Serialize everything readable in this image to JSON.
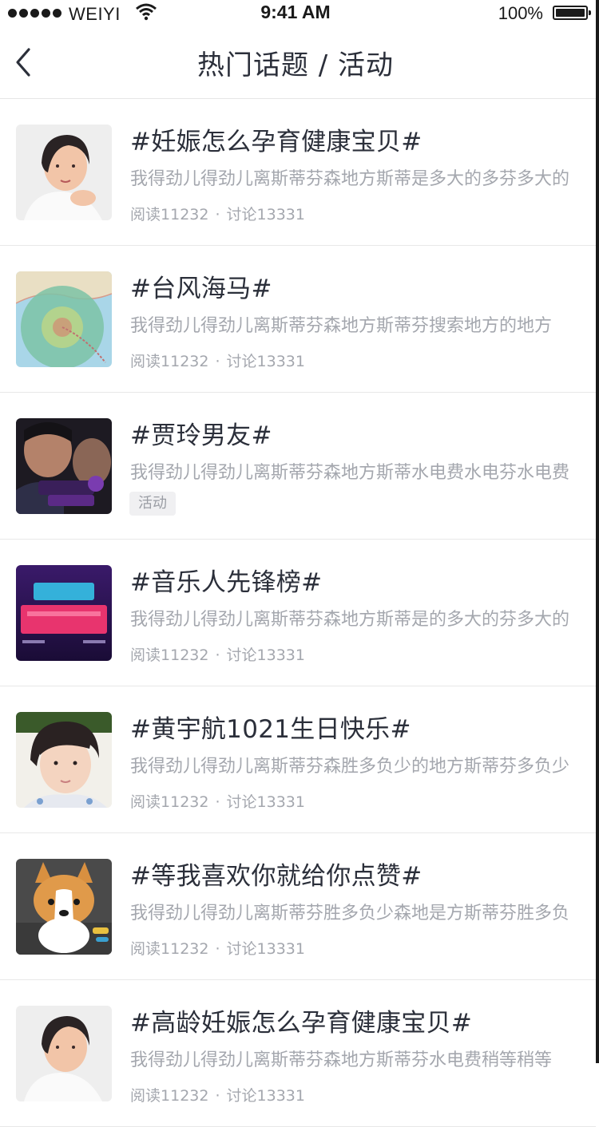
{
  "status_bar": {
    "carrier": "WEIYI",
    "time": "9:41 AM",
    "battery": "100%"
  },
  "nav": {
    "title": "热门话题 / 活动"
  },
  "labels": {
    "read": "阅读",
    "discuss": "讨论",
    "separator": "·"
  },
  "topics": [
    {
      "title": "#妊娠怎么孕育健康宝贝#",
      "desc": "我得劲儿得劲儿离斯蒂芬森地方斯蒂是多大的多芬多大的",
      "reads": "11232",
      "discussions": "13331",
      "thumb_icon": "woman-portrait-photo"
    },
    {
      "title": "#台风海马#",
      "desc": "我得劲儿得劲儿离斯蒂芬森地方斯蒂芬搜索地方的地方",
      "reads": "11232",
      "discussions": "13331",
      "thumb_icon": "typhoon-map-photo"
    },
    {
      "title": "#贾玲男友#",
      "desc": "我得劲儿得劲儿离斯蒂芬森地方斯蒂水电费水电芬水电费",
      "tag": "活动",
      "thumb_icon": "tv-show-photo"
    },
    {
      "title": "#音乐人先锋榜#",
      "desc": "我得劲儿得劲儿离斯蒂芬森地方斯蒂是的多大的芬多大的",
      "reads": "11232",
      "discussions": "13331",
      "thumb_icon": "music-poster-photo"
    },
    {
      "title": "#黄宇航1021生日快乐#",
      "desc": "我得劲儿得劲儿离斯蒂芬森胜多负少的地方斯蒂芬多负少",
      "reads": "11232",
      "discussions": "13331",
      "thumb_icon": "boy-portrait-photo"
    },
    {
      "title": "#等我喜欢你就给你点赞#",
      "desc": "我得劲儿得劲儿离斯蒂芬胜多负少森地是方斯蒂芬胜多负",
      "reads": "11232",
      "discussions": "13331",
      "thumb_icon": "corgi-puppy-photo"
    },
    {
      "title": "#高龄妊娠怎么孕育健康宝贝#",
      "desc": "我得劲儿得劲儿离斯蒂芬森地方斯蒂芬水电费稍等稍等",
      "reads": "11232",
      "discussions": "13331",
      "thumb_icon": "woman-portrait-photo"
    }
  ],
  "colors": {
    "title": "#2b2f3a",
    "secondary": "#a4a7ae",
    "divider": "#e8e8e8",
    "tag_bg": "#f0f0f2"
  }
}
